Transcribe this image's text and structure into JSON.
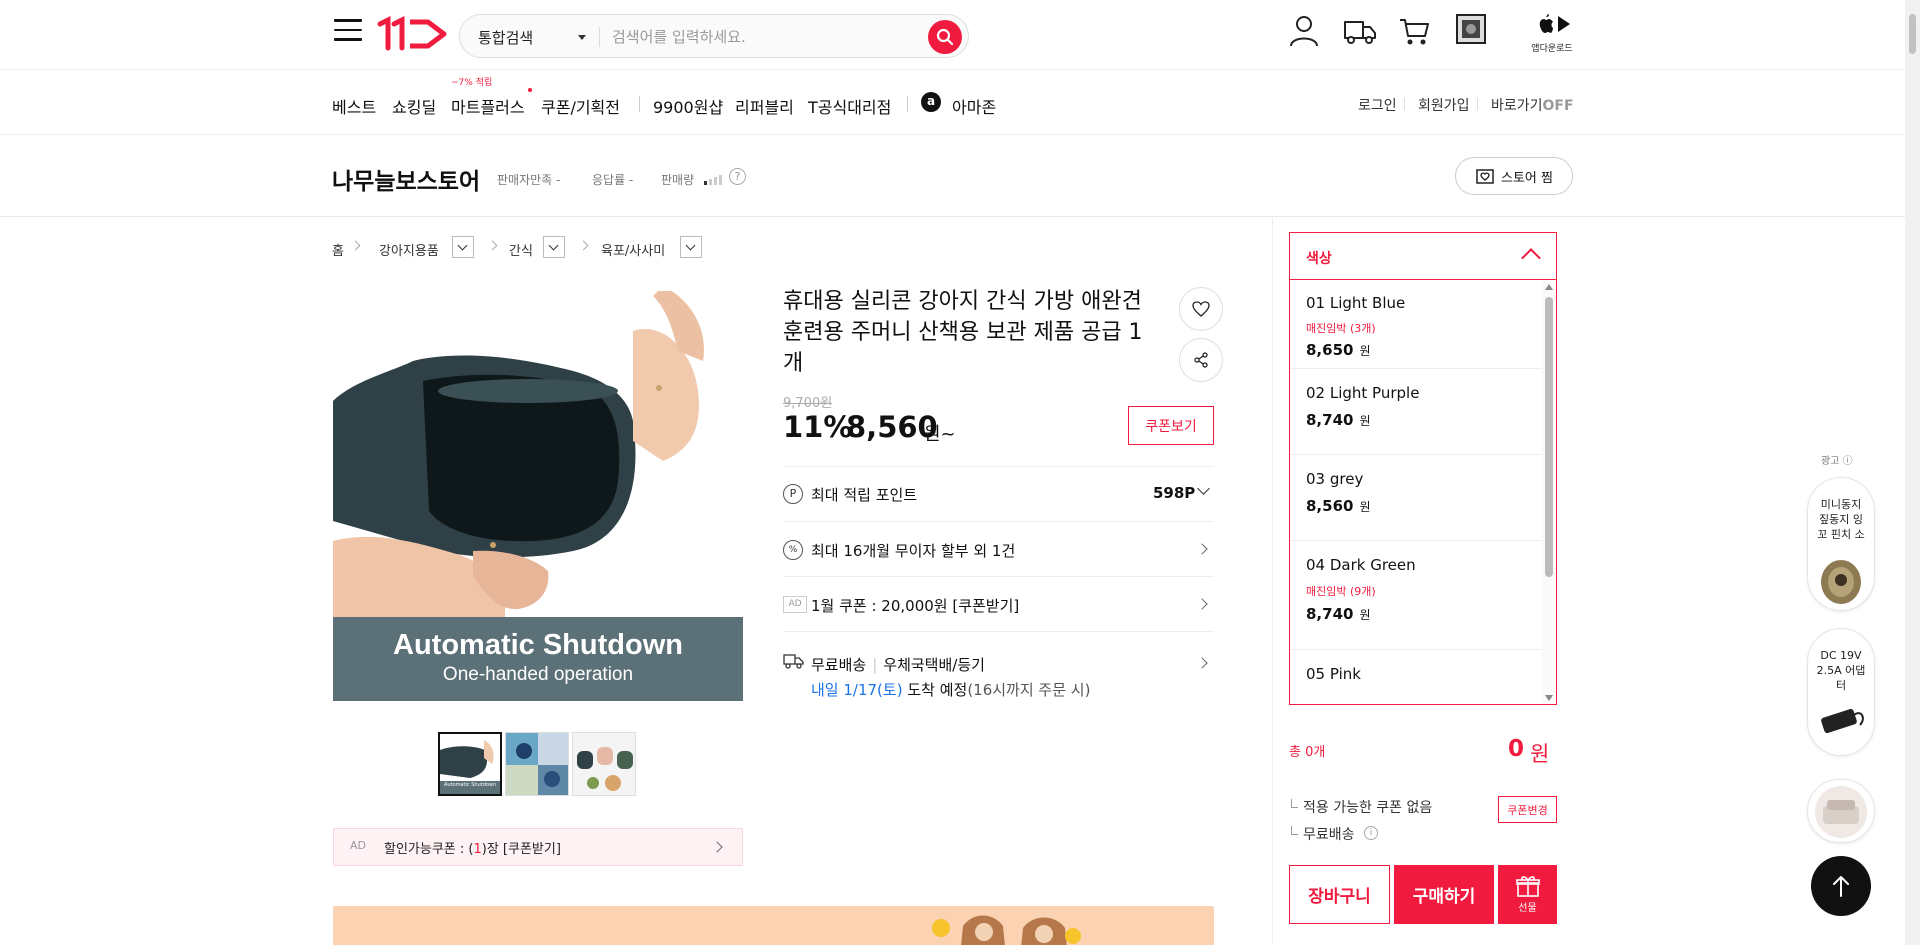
{
  "header": {
    "search_category": "통합검색",
    "search_placeholder": "검색어를 입력하세요.",
    "app_download_label": "앱다운로드"
  },
  "nav": {
    "items": [
      "베스트",
      "쇼킹딜",
      "마트플러스",
      "쿠폰/기획전",
      "9900원샵",
      "리퍼블리",
      "T공식대리점",
      "아마존"
    ],
    "mart_badge": "~7% 적립",
    "amazon_icon_letter": "a",
    "right": {
      "login": "로그인",
      "signup": "회원가입",
      "quick_go": "바로가기",
      "quick_go_state": "OFF"
    }
  },
  "store": {
    "name": "나무늘보스토어",
    "satisfaction": "판매자만족 -",
    "response": "응답률 -",
    "sales": "판매량",
    "help": "?",
    "fav_label": "스토어 찜"
  },
  "breadcrumb": [
    "홈",
    "강아지용품",
    "간식",
    "육포/사사미"
  ],
  "gallery": {
    "caption_line1": "Automatic Shutdown",
    "caption_line2": "One-handed operation",
    "thumb1_caption": "Automatic Shutdown"
  },
  "coupon_bar": {
    "ad": "AD",
    "prefix": "할인가능쿠폰 : (",
    "count": "1",
    "suffix": ")장 [쿠폰받기]"
  },
  "product": {
    "title": "휴대용 실리콘 강아지 간식 가방 애완견 훈련용 주머니 산책용 보관 제품 공급 1개",
    "original_price": "9,700원",
    "discount": "11%",
    "price": "8,560",
    "price_unit": "원~",
    "coupon_view": "쿠폰보기",
    "points_label": "최대 적립 포인트",
    "points_value": "598P",
    "installment": "최대 16개월 무이자 할부 외 1건",
    "ad_tag": "AD",
    "coupon_ad": "1월 쿠폰 : 20,000원 [쿠폰받기]",
    "shipping_free": "무료배송",
    "shipping_method": "우체국택배/등기",
    "delivery_date": "내일 1/17(토)",
    "delivery_suffix": " 도착 예정",
    "delivery_note": "(16시까지 주문 시)"
  },
  "options": {
    "header": "색상",
    "items": [
      {
        "name": "01 Light Blue",
        "stock": "매진임박 (3개)",
        "price": "8,650",
        "unit": "원"
      },
      {
        "name": "02 Light Purple",
        "stock": "",
        "price": "8,740",
        "unit": "원"
      },
      {
        "name": "03 grey",
        "stock": "",
        "price": "8,560",
        "unit": "원"
      },
      {
        "name": "04 Dark Green",
        "stock": "매진임박 (9개)",
        "price": "8,740",
        "unit": "원"
      },
      {
        "name": "05 Pink",
        "stock": "",
        "price": "",
        "unit": ""
      }
    ]
  },
  "summary": {
    "total_label": "총 0개",
    "total_value": "0",
    "total_unit": "원",
    "no_coupon": "적용 가능한 쿠폰 없음",
    "coupon_change": "쿠폰변경",
    "free_shipping": "무료배송",
    "cart": "장바구니",
    "buy": "구매하기",
    "gift": "선물"
  },
  "side_ads": {
    "label": "광고",
    "card1": "미니동지 짚동지 잉꼬 핀치 소",
    "card2": "DC 19V 2.5A 어댑터"
  },
  "colors": {
    "accent": "#f01b3e",
    "link_blue": "#1a73e8"
  }
}
